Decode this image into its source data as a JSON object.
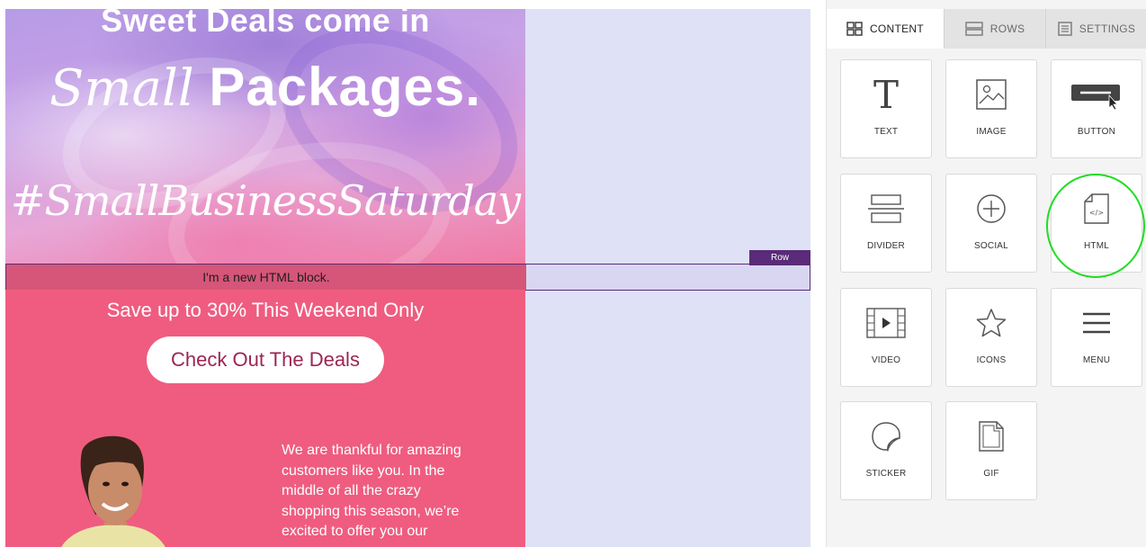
{
  "canvas": {
    "hero": {
      "title_line1": "Sweet Deals come in",
      "title_script": "Small",
      "title_bold": "Packages.",
      "hashtag": "#SmallBusinessSaturday"
    },
    "html_block_text": "I'm a new HTML block.",
    "row_tag": "Row",
    "promo": {
      "headline": "Save up to 30% This Weekend Only",
      "cta_label": "Check Out The Deals",
      "body_lines": [
        "We are thankful for amazing",
        "customers like you. In the",
        "middle of all the crazy",
        "shopping this season, we’re",
        "excited to offer you our"
      ]
    }
  },
  "panel": {
    "tabs": [
      {
        "label": "CONTENT",
        "icon": "grid-icon",
        "active": true
      },
      {
        "label": "ROWS",
        "icon": "rows-icon",
        "active": false
      },
      {
        "label": "SETTINGS",
        "icon": "settings-icon",
        "active": false
      }
    ],
    "tiles": [
      {
        "label": "TEXT",
        "icon": "text-icon"
      },
      {
        "label": "IMAGE",
        "icon": "image-icon"
      },
      {
        "label": "BUTTON",
        "icon": "button-icon"
      },
      {
        "label": "DIVIDER",
        "icon": "divider-icon"
      },
      {
        "label": "SOCIAL",
        "icon": "social-plus-icon"
      },
      {
        "label": "HTML",
        "icon": "html-file-icon"
      },
      {
        "label": "VIDEO",
        "icon": "video-icon"
      },
      {
        "label": "ICONS",
        "icon": "star-icon"
      },
      {
        "label": "MENU",
        "icon": "menu-icon"
      },
      {
        "label": "STICKER",
        "icon": "sticker-icon"
      },
      {
        "label": "GIF",
        "icon": "gif-file-icon"
      }
    ]
  },
  "colors": {
    "promo_pink": "#ef5c80",
    "row_purple": "#5a2b78",
    "cta_text": "#9b2653",
    "highlight": "#22dd22"
  }
}
